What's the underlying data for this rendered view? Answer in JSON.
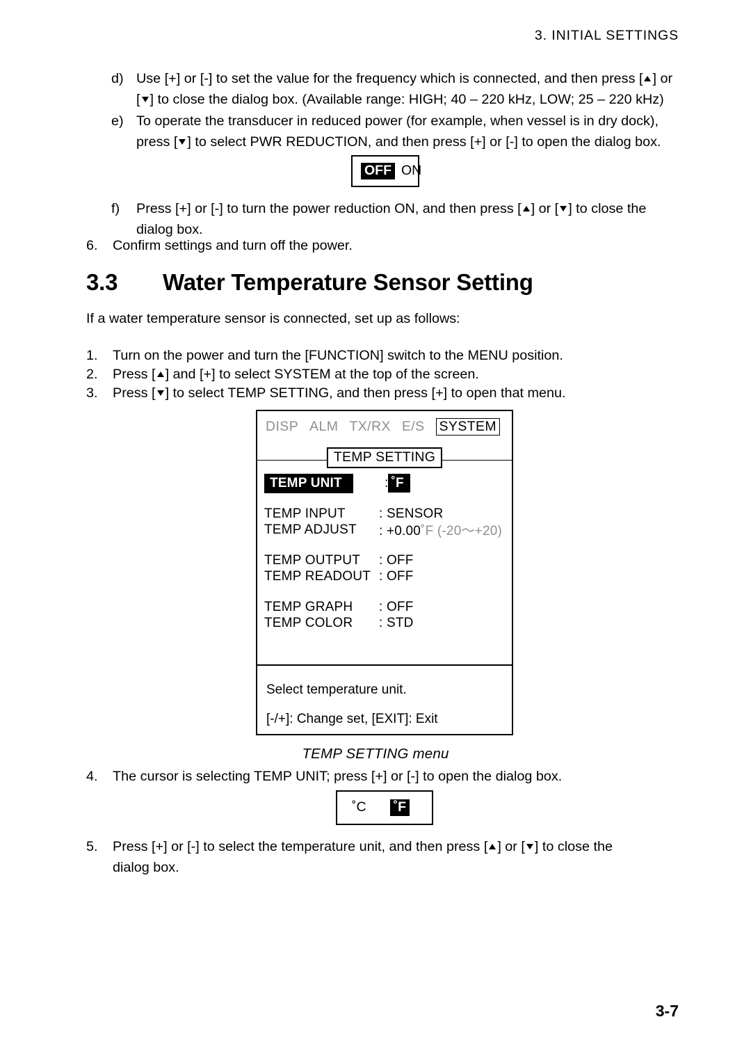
{
  "header": {
    "running_head": "3. INITIAL SETTINGS"
  },
  "steps_top": [
    {
      "marker": "d)",
      "line1_a": "Use [+] or [-] to set the value for the frequency which is connected, and then press [",
      "line1_b": "] or",
      "line2_a": "[",
      "line2_b": "] to close the dialog box. (Available range: HIGH; 40 – 220 kHz, LOW; 25 – 220 kHz)"
    },
    {
      "marker": "e)",
      "line1": "To operate the transducer in reduced power (for example, when vessel is in dry dock),",
      "line2_a": "press [",
      "line2_b": "] to select PWR REDUCTION, and then press [+] or [-] to open the dialog box."
    },
    {
      "marker": "f)",
      "line1_a": "Press [+] or [-] to turn the power reduction ON, and then press [",
      "line1_b": "] or [",
      "line1_c": "] to close the",
      "line2": "dialog box."
    },
    {
      "marker": "6.",
      "line1": "Confirm settings and turn off the power."
    }
  ],
  "dialog_power_reduction": {
    "name": "PWR REDUCTION dialog",
    "selected_option": "OFF",
    "other_option": "ON"
  },
  "section": {
    "number": "3.3",
    "title": "Water Temperature Sensor Setting",
    "intro": "If a water temperature sensor is connected, set up as follows:"
  },
  "procedure": [
    {
      "marker": "1.",
      "text": "Turn on the power and turn the [FUNCTION] switch to the MENU position."
    },
    {
      "marker": "2.",
      "text_a": "Press [",
      "text_b": "] and [+] to select SYSTEM at the top of the screen."
    },
    {
      "marker": "3.",
      "text_a": "Press [",
      "text_b": "] to select TEMP SETTING, and then press [+] to open that menu."
    }
  ],
  "menu_screen": {
    "tabs": [
      "DISP",
      "ALM",
      "TX/RX",
      "E/S",
      "SYSTEM"
    ],
    "selected_tab": "SYSTEM",
    "title": "TEMP SETTING",
    "items": [
      {
        "label": "TEMP UNIT",
        "value": "˚F",
        "selected": true
      },
      {
        "label": "TEMP INPUT",
        "value": ": SENSOR",
        "selected": false
      },
      {
        "label": "TEMP ADJUST",
        "value": ": +0.00",
        "value_unit": "˚F",
        "value_range": "(-20～+20)",
        "selected": false
      },
      {
        "label": "TEMP OUTPUT",
        "value": ": OFF",
        "selected": false
      },
      {
        "label": "TEMP READOUT",
        "value": ": OFF",
        "selected": false
      },
      {
        "label": "TEMP GRAPH",
        "value": ": OFF",
        "selected": false
      },
      {
        "label": "TEMP COLOR",
        "value": ": STD",
        "selected": false
      }
    ],
    "selected_value_prefix": ":",
    "footer_line1": "Select temperature unit.",
    "footer_line2": "[-/+]: Change set, [EXIT]: Exit"
  },
  "figure_caption": "TEMP SETTING menu",
  "steps_bottom": [
    {
      "marker": "4.",
      "line1": "The cursor is selecting TEMP UNIT; press [+] or [-] to open the dialog box."
    },
    {
      "marker": "5.",
      "line1_a": "Press [+] or [-] to select the temperature unit, and then press [",
      "line1_b": "] or [",
      "line1_c": "] to close the",
      "line2": "dialog box."
    }
  ],
  "dialog_temp_unit": {
    "name": "TEMP UNIT dialog",
    "option_celsius": "˚C",
    "option_fahrenheit": "˚F",
    "selected_option": "˚F"
  },
  "page_number": "3-7",
  "colors": {
    "text": "#000000",
    "dim_text": "#8f8f8f",
    "highlight_bg": "#000000",
    "highlight_fg": "#ffffff",
    "page_bg": "#ffffff"
  }
}
